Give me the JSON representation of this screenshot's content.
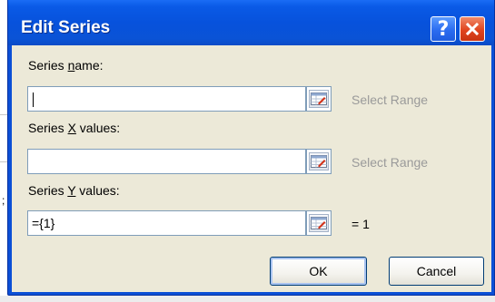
{
  "dialog": {
    "title": "Edit Series",
    "help_glyph": "?",
    "close_icon": "close-icon"
  },
  "series_name": {
    "label_before": "Series ",
    "label_mnemonic": "n",
    "label_after": "ame:",
    "value": "",
    "side_text": "Select Range"
  },
  "series_x": {
    "label_before": "Series ",
    "label_mnemonic": "X",
    "label_after": " values:",
    "value": "",
    "side_text": "Select Range"
  },
  "series_y": {
    "label_before": "Series ",
    "label_mnemonic": "Y",
    "label_after": " values:",
    "value": "={1}",
    "side_text": "= 1"
  },
  "buttons": {
    "ok": "OK",
    "cancel": "Cancel"
  },
  "background": {
    "left_mark": ";"
  },
  "colors": {
    "titlebar": "#0752dc",
    "client": "#ece9d8",
    "close_red": "#e0441e",
    "button_border": "#003c74"
  }
}
